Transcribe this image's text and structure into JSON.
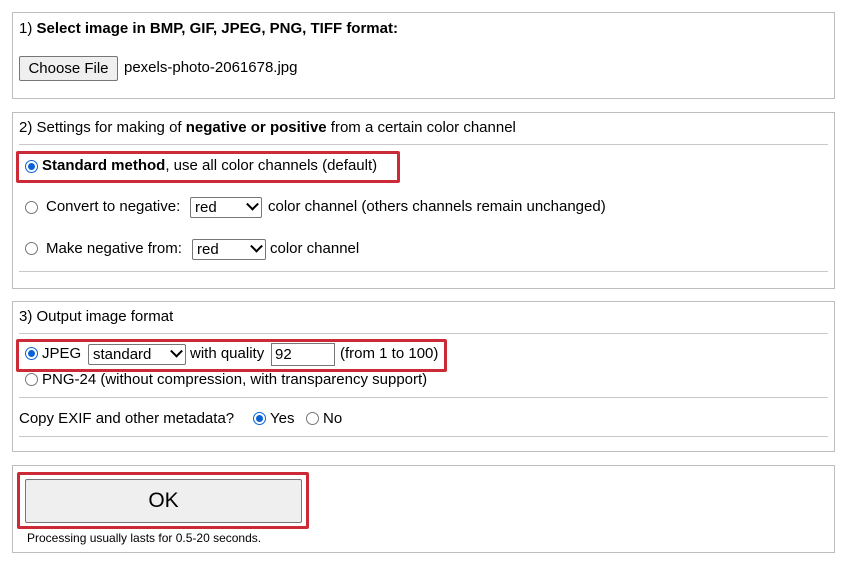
{
  "section1": {
    "number": "1)",
    "title": "Select image in BMP, GIF, JPEG, PNG, TIFF format:",
    "choose_file_button": "Choose File",
    "file_name": "pexels-photo-2061678.jpg"
  },
  "section2": {
    "prefix": "2) Settings for making of ",
    "title_bold": "negative or positive",
    "suffix": " from a certain color channel",
    "option_standard_bold": "Standard method",
    "option_standard_rest": ", use all color channels (default)",
    "option_convert_label": "Convert to negative:",
    "option_convert_select": "red",
    "option_convert_rest": "color channel (others channels remain unchanged)",
    "option_make_label": "Make negative from:",
    "option_make_select": "red",
    "option_make_rest": "color channel"
  },
  "section3": {
    "title": "3) Output image format",
    "jpeg_label": "JPEG",
    "jpeg_select": "standard",
    "quality_label": "with quality",
    "quality_value": "92",
    "quality_range": "(from 1 to 100)",
    "png_label": "PNG-24 (without compression, with transparency support)",
    "exif_label": "Copy EXIF and other metadata?",
    "exif_yes": "Yes",
    "exif_no": "No"
  },
  "section4": {
    "ok_button": "OK",
    "note": "Processing usually lasts for 0.5-20 seconds."
  },
  "colors": {
    "highlight": "#cc2a36",
    "radio_selected": "#0b62d6",
    "border": "#bdbdbd"
  }
}
